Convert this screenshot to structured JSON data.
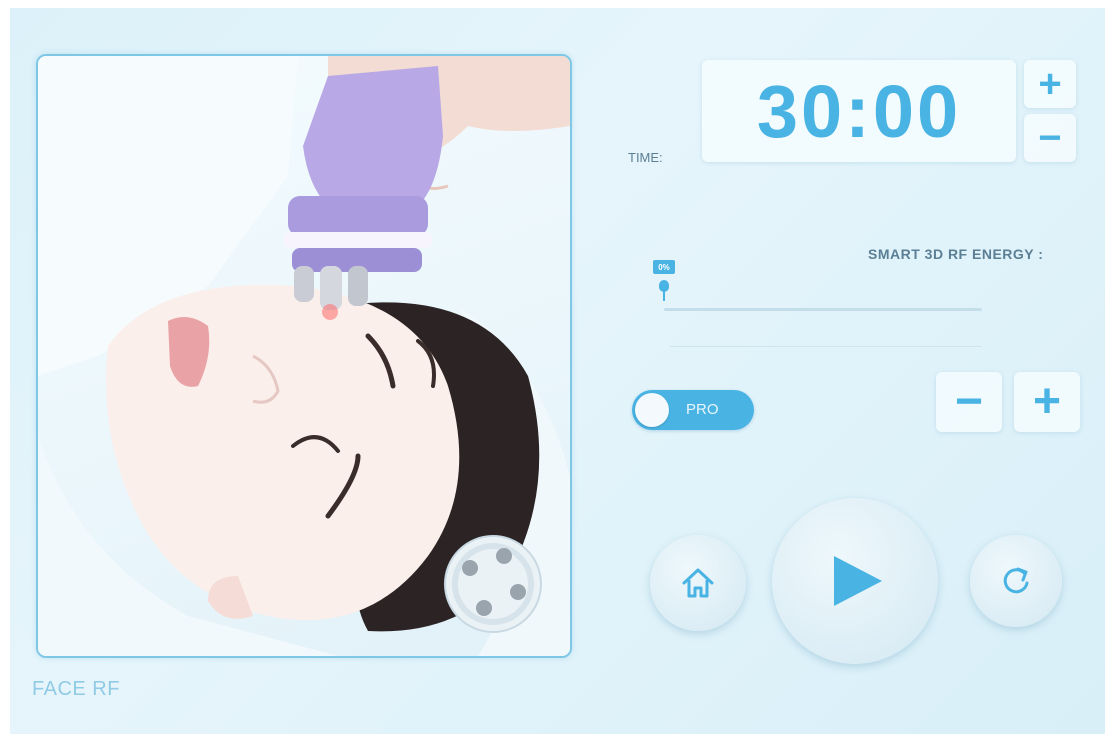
{
  "mode": {
    "label": "FACE RF"
  },
  "time": {
    "label": "TIME:",
    "value": "30:00",
    "plus": "+",
    "minus": "−"
  },
  "energy": {
    "label": "SMART 3D RF ENERGY :",
    "percent_label": "0%",
    "level": 0,
    "minus": "−",
    "plus": "+"
  },
  "pro_toggle": {
    "label": "PRO",
    "on": false
  },
  "controls": {
    "home_icon": "home-icon",
    "play_icon": "play-icon",
    "reset_icon": "refresh-icon"
  },
  "colors": {
    "accent": "#49b3e3",
    "background": "#dcf1f9",
    "frame": "#7ec8e6"
  }
}
